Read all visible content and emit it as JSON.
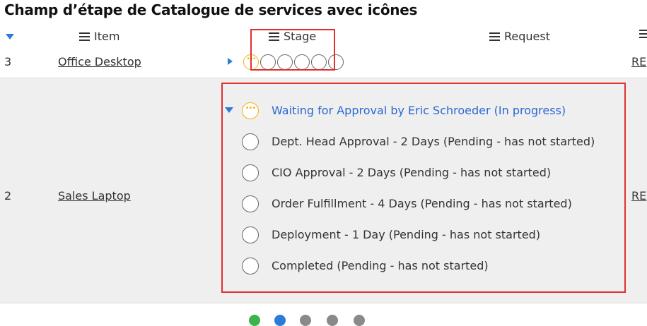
{
  "title": "Champ d’étape de Catalogue de services avec icônes",
  "header": {
    "columns": [
      {
        "label": "Item"
      },
      {
        "label": "Stage"
      },
      {
        "label": "Request"
      }
    ]
  },
  "rows": [
    {
      "number": "3",
      "item": "Office Desktop",
      "request": "RE"
    },
    {
      "number": "2",
      "item": "Sales Laptop",
      "request": "RE"
    }
  ],
  "stages": [
    {
      "label": "Waiting for Approval by Eric Schroeder (In progress)",
      "status": "in-progress"
    },
    {
      "label": "Dept. Head Approval - 2 Days (Pending - has not started)",
      "status": "pending"
    },
    {
      "label": "CIO Approval - 2 Days (Pending - has not started)",
      "status": "pending"
    },
    {
      "label": "Order Fulfillment - 4 Days (Pending - has not started)",
      "status": "pending"
    },
    {
      "label": "Deployment - 1 Day (Pending - has not started)",
      "status": "pending"
    },
    {
      "label": "Completed (Pending - has not started)",
      "status": "pending"
    }
  ],
  "colors": {
    "highlight": "#e03030",
    "link_blue": "#2b68d1",
    "in_progress": "#f1b20a",
    "dot_colors": [
      "#3cb44b",
      "#2b7bd9",
      "#8a8a8a",
      "#8a8a8a",
      "#8a8a8a"
    ]
  }
}
